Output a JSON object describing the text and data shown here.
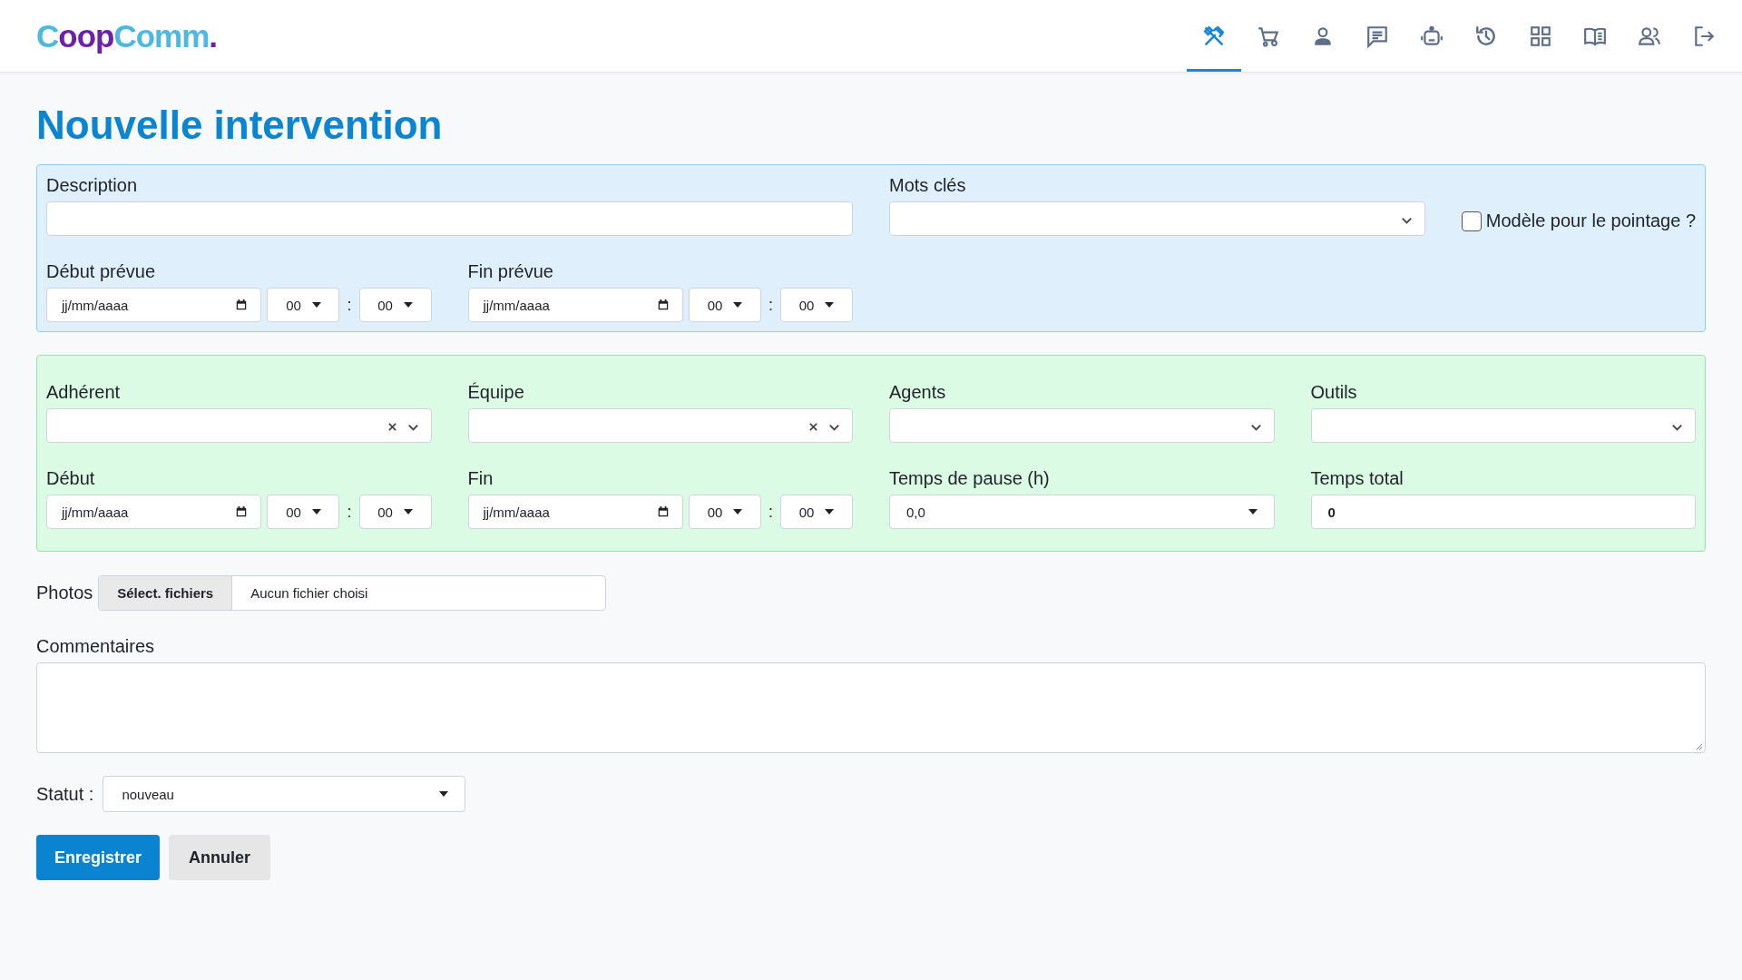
{
  "logo": [
    {
      "text": "C",
      "color": "#4db9e3"
    },
    {
      "text": "oop",
      "color": "#6b21a8"
    },
    {
      "text": "Comm",
      "color": "#4db9e3"
    },
    {
      "text": ".",
      "color": "#6b21a8"
    }
  ],
  "nav": [
    {
      "kind": "tools",
      "selected": true
    },
    {
      "kind": "cart",
      "selected": false
    },
    {
      "kind": "person",
      "selected": false
    },
    {
      "kind": "chat",
      "selected": false
    },
    {
      "kind": "robot",
      "selected": false
    },
    {
      "kind": "history",
      "selected": false
    },
    {
      "kind": "grid",
      "selected": false
    },
    {
      "kind": "book",
      "selected": false
    },
    {
      "kind": "people",
      "selected": false
    },
    {
      "kind": "logout",
      "selected": false
    }
  ],
  "title": "Nouvelle intervention",
  "planning": {
    "description": {
      "label": "Description"
    },
    "keywords": {
      "label": "Mots clés"
    },
    "template_checkbox": {
      "label": "Modèle pour le pointage ?",
      "checked": false
    },
    "start": {
      "label": "Début prévue",
      "date_placeholder": "jj/mm/aaaa",
      "hour": "00",
      "separator": ":",
      "minute": "00"
    },
    "end": {
      "label": "Fin prévue",
      "date_placeholder": "jj/mm/aaaa",
      "hour": "00",
      "separator": ":",
      "minute": "00"
    }
  },
  "execution": {
    "fields": [
      {
        "kind": "select",
        "label": "Adhérent",
        "clearable": true
      },
      {
        "kind": "select",
        "label": "Équipe",
        "clearable": true
      },
      {
        "kind": "select",
        "label": "Agents",
        "clearable": false
      },
      {
        "kind": "select",
        "label": "Outils",
        "clearable": false
      },
      {
        "kind": "datetime",
        "label": "Début",
        "date_placeholder": "jj/mm/aaaa",
        "hour": "00",
        "separator": ":",
        "minute": "00"
      },
      {
        "kind": "datetime",
        "label": "Fin",
        "date_placeholder": "jj/mm/aaaa",
        "hour": "00",
        "separator": ":",
        "minute": "00"
      },
      {
        "kind": "dropdown",
        "label": "Temps de pause (h)",
        "value": "0,0"
      },
      {
        "kind": "text",
        "label": "Temps total",
        "value": "0"
      }
    ]
  },
  "photos": {
    "label": "Photos",
    "button": "Sélect. fichiers",
    "status": "Aucun fichier choisi"
  },
  "comments": {
    "label": "Commentaires"
  },
  "status": {
    "label": "Statut :",
    "value": "nouveau"
  },
  "buttons": [
    {
      "kind": "primary",
      "label": "Enregistrer"
    },
    {
      "kind": "secondary",
      "label": "Annuler"
    }
  ]
}
